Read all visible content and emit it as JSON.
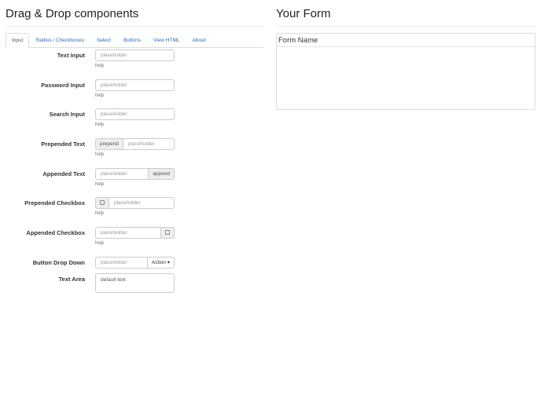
{
  "left": {
    "title": "Drag & Drop components",
    "tabs": [
      "Input",
      "Radios / Checkboxes",
      "Select",
      "Buttons",
      "View HTML",
      "About"
    ],
    "fields": [
      {
        "label": "Text Input",
        "placeholder": "placeholder",
        "help": "help"
      },
      {
        "label": "Password Input",
        "placeholder": "placeholder",
        "help": "help"
      },
      {
        "label": "Search Input",
        "placeholder": "placeholder",
        "help": "help"
      },
      {
        "label": "Prepended Text",
        "prepend": "prepend",
        "placeholder": "placeholder",
        "help": "help"
      },
      {
        "label": "Appended Text",
        "append": "append",
        "placeholder": "placeholder",
        "help": "help"
      },
      {
        "label": "Prepended Checkbox",
        "placeholder": "placeholder",
        "help": "help"
      },
      {
        "label": "Appended Checkbox",
        "placeholder": "placeholder",
        "help": "help"
      },
      {
        "label": "Button Drop Down",
        "placeholder": "placeholder",
        "button": "Action ▾"
      },
      {
        "label": "Text Area",
        "value": "default text"
      }
    ]
  },
  "right": {
    "title": "Your Form",
    "legend": "Form Name"
  }
}
